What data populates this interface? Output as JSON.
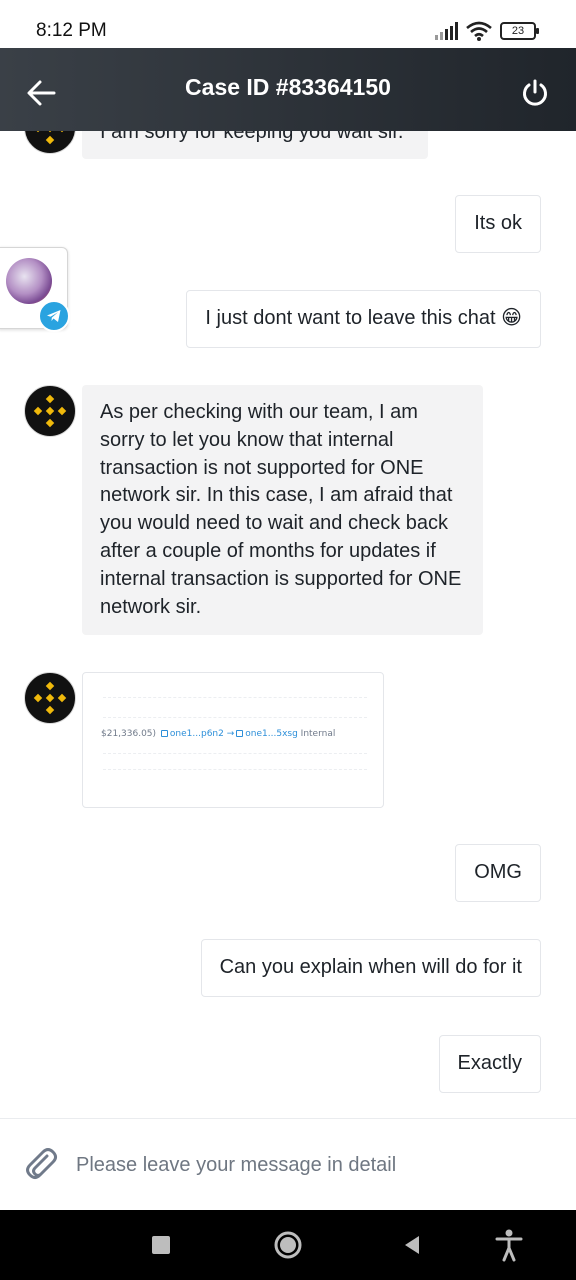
{
  "status_bar": {
    "time": "8:12 PM",
    "battery": "23"
  },
  "header": {
    "title": "Case ID #83364150"
  },
  "messages": {
    "partial": "I am sorry for keeping you wait sir.",
    "user_1": "Its ok",
    "user_2": "I just dont want to leave this chat 😁",
    "agent_1": "As per checking with our team, I am sorry to let you know that internal transaction is not supported for ONE network sir. In this case, I am afraid that you would need to wait and check back after a couple of months for updates if internal transaction is supported for ONE network sir.",
    "agent_image": {
      "amount": "$21,336.05)",
      "from": "one1...p6n2",
      "arrow": "→",
      "to": "one1...5xsg",
      "type": "Internal"
    },
    "user_3": "OMG",
    "user_4": "Can you explain when will do for it",
    "user_5": "Exactly"
  },
  "composer": {
    "placeholder": "Please leave your message in detail"
  },
  "colors": {
    "accent": "#F0B90B",
    "header_start": "#3a4047",
    "header_end": "#20252b",
    "agent_bubble": "#f3f3f4"
  }
}
